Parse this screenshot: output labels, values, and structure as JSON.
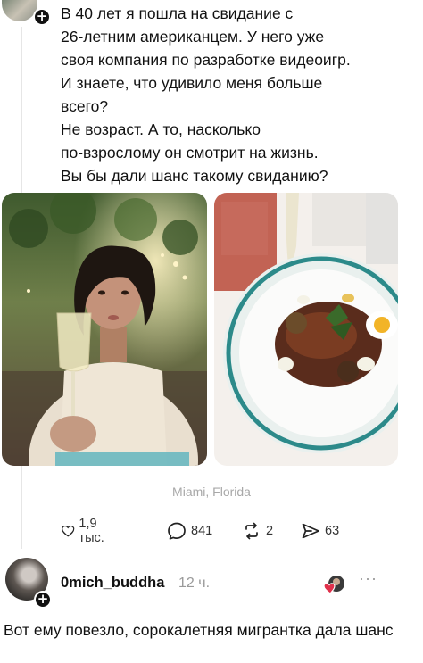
{
  "post": {
    "text": "В 40 лет я пошла на свидание с\n26-летним американцем. У него уже\nсвоя компания по разработке видеоигр.\nИ знаете, что удивило меня больше\nвсего?\nНе возраст. А то, насколько\nпо-взрослому он смотрит на жизнь.\nВы бы дали шанс такому свиданию?",
    "location": "Miami, Florida",
    "likes": "1,9 тыс.",
    "comments": "841",
    "reposts": "2",
    "shares": "63"
  },
  "reply": {
    "username": "0mich_buddha",
    "time": "12 ч.",
    "more": "···",
    "text": "Вот ему повезло, сорокалетняя мигрантка дала шанс"
  },
  "icons": {
    "like": "heart-outline-icon",
    "comment": "speech-bubble-icon",
    "repost": "repost-arrows-icon",
    "share": "paper-plane-icon",
    "badge": "plus-icon"
  },
  "colors": {
    "text": "#111111",
    "muted": "#9a9a9a",
    "location": "#a8a8a8",
    "heart": "#e0314b"
  }
}
